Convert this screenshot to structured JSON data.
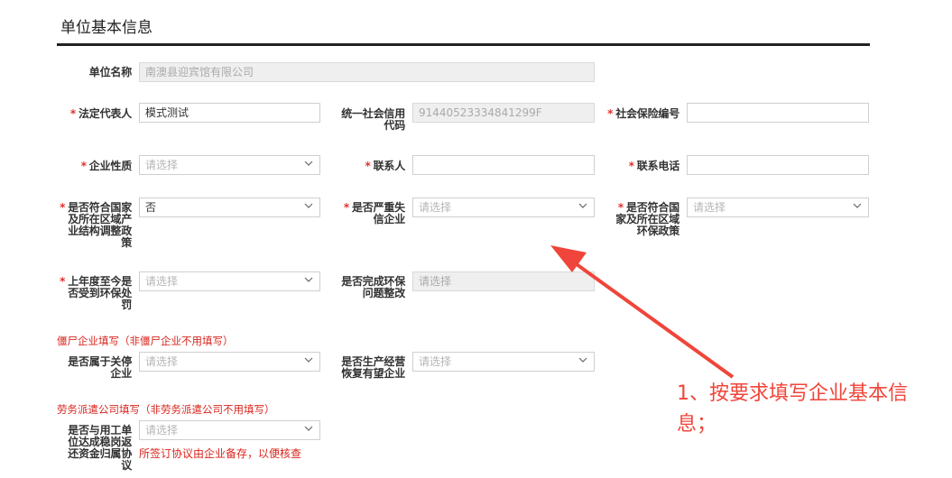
{
  "header": {
    "title": "单位基本信息"
  },
  "fields": {
    "unit_name": {
      "label": "单位名称",
      "value": "南澳县迎宾馆有限公司"
    },
    "legal_rep": {
      "label": "法定代表人",
      "value": "模式测试"
    },
    "credit_code": {
      "label": "统一社会信用代码",
      "value": "91440523334841299F"
    },
    "social_security": {
      "label": "社会保险编号",
      "value": ""
    },
    "enterprise_nature": {
      "label": "企业性质",
      "placeholder": "请选择"
    },
    "contact_person": {
      "label": "联系人",
      "value": ""
    },
    "contact_phone": {
      "label": "联系电话",
      "value": ""
    },
    "industry_policy": {
      "label": "是否符合国家及所在区域产业结构调整政策",
      "value": "否"
    },
    "serious_dishonest": {
      "label": "是否严重失信企业",
      "placeholder": "请选择"
    },
    "env_policy": {
      "label": "是否符合国家及所在区域环保政策",
      "placeholder": "请选择"
    },
    "env_penalty": {
      "label": "上年度至今是否受到环保处罚",
      "placeholder": "请选择"
    },
    "env_rectification": {
      "label": "是否完成环保问题整改",
      "placeholder": "请选择"
    },
    "shutdown": {
      "label": "是否属于关停企业",
      "placeholder": "请选择"
    },
    "resume_production": {
      "label": "是否生产经营恢复有望企业",
      "placeholder": "请选择"
    },
    "agreement": {
      "label": "是否与用工单位达成稳岗返还资金归属协议",
      "placeholder": "请选择"
    }
  },
  "notes": {
    "zombie": "僵尸企业填写（非僵尸企业不用填写）",
    "labor_dispatch": "劳务派遣公司填写（非劳务派遣公司不用填写）",
    "agreement_hint": "所签订协议由企业备存，以便核查"
  },
  "annotation": {
    "text": "1、按要求填写企业基本信息；"
  },
  "colors": {
    "required": "#e0302b",
    "annotation": "#f0453a",
    "note": "#d9251d"
  }
}
